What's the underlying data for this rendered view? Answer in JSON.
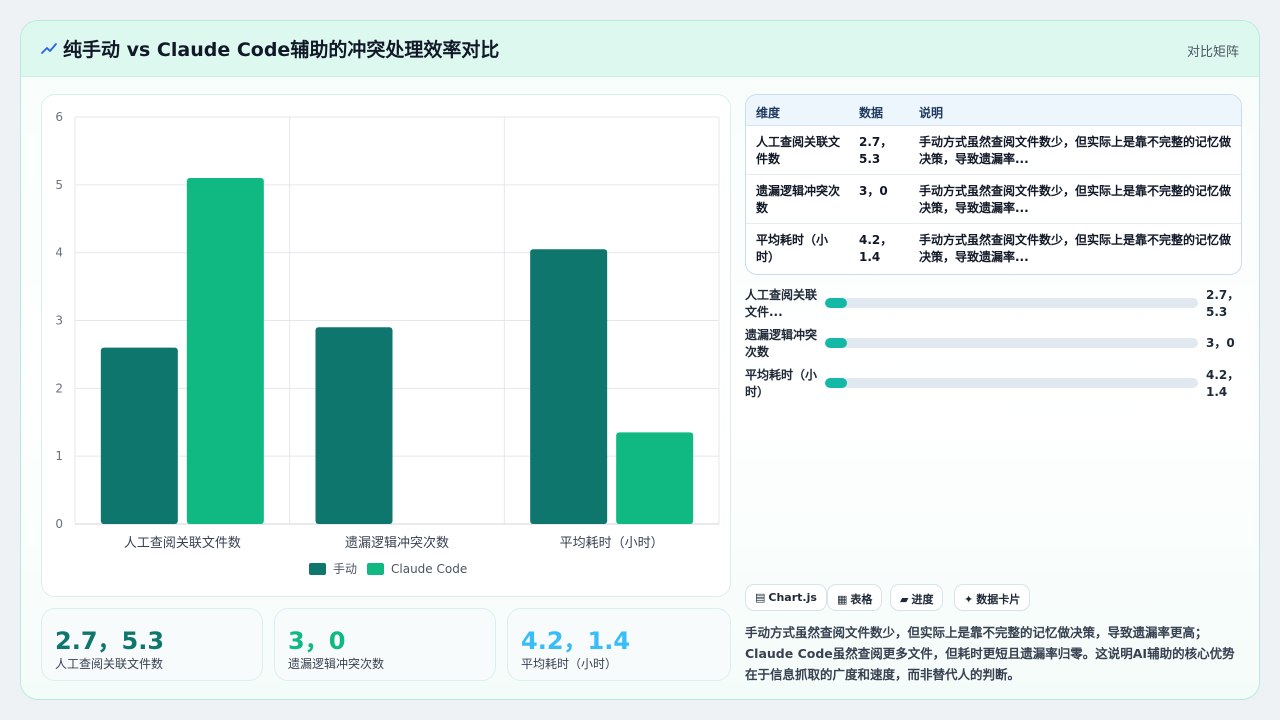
{
  "header": {
    "title": "纯手动 vs Claude Code辅助的冲突处理效率对比",
    "tag": "对比矩阵",
    "icon": "chart-trend-icon"
  },
  "chart_data": {
    "type": "bar",
    "categories": [
      "人工查阅关联文件数",
      "遗漏逻辑冲突次数",
      "平均耗时（小时）"
    ],
    "series": [
      {
        "name": "手动",
        "values": [
          2.6,
          2.9,
          4.05
        ],
        "color": "#0f766e"
      },
      {
        "name": "Claude Code",
        "values": [
          5.1,
          0,
          1.35
        ],
        "color": "#10b981"
      }
    ],
    "ylim": [
      0,
      6
    ],
    "yticks": [
      0,
      1,
      2,
      3,
      4,
      5,
      6
    ],
    "grid": true,
    "legend": "bottom"
  },
  "kpis": [
    {
      "value": "2.7，5.3",
      "label": "人工查阅关联文件数",
      "color": "#0f766e"
    },
    {
      "value": "3，0",
      "label": "遗漏逻辑冲突次数",
      "color": "#10b981"
    },
    {
      "value": "4.2，1.4",
      "label": "平均耗时（小时）",
      "color": "#38bdf8"
    }
  ],
  "table": {
    "headers": [
      "维度",
      "数据",
      "说明"
    ],
    "rows": [
      {
        "dim": "人工查阅关联文件数",
        "data": "2.7，5.3",
        "note": "手动方式虽然查阅文件数少，但实际上是靠不完整的记忆做决策，导致遗漏率..."
      },
      {
        "dim": "遗漏逻辑冲突次数",
        "data": "3，0",
        "note": "手动方式虽然查阅文件数少，但实际上是靠不完整的记忆做决策，导致遗漏率..."
      },
      {
        "dim": "平均耗时（小时）",
        "data": "4.2，1.4",
        "note": "手动方式虽然查阅文件数少，但实际上是靠不完整的记忆做决策，导致遗漏率..."
      }
    ]
  },
  "progress": [
    {
      "label": "人工查阅关联文件...",
      "value": "2.7，5.3",
      "fraction": 0.06
    },
    {
      "label": "遗漏逻辑冲突次数",
      "value": "3，0",
      "fraction": 0.06
    },
    {
      "label": "平均耗时（小时）",
      "value": "4.2，1.4",
      "fraction": 0.06
    }
  ],
  "chips": [
    {
      "icon": "▤",
      "label": "Chart.js"
    },
    {
      "icon": "▦",
      "label": "表格"
    },
    {
      "icon": "▰",
      "label": "进度"
    },
    {
      "icon": "✦",
      "label": "数据卡片"
    }
  ],
  "summary": "手动方式虽然查阅文件数少，但实际上是靠不完整的记忆做决策，导致遗漏率更高；Claude Code虽然查阅更多文件，但耗时更短且遗漏率归零。这说明AI辅助的核心优势在于信息抓取的广度和速度，而非替代人的判断。"
}
